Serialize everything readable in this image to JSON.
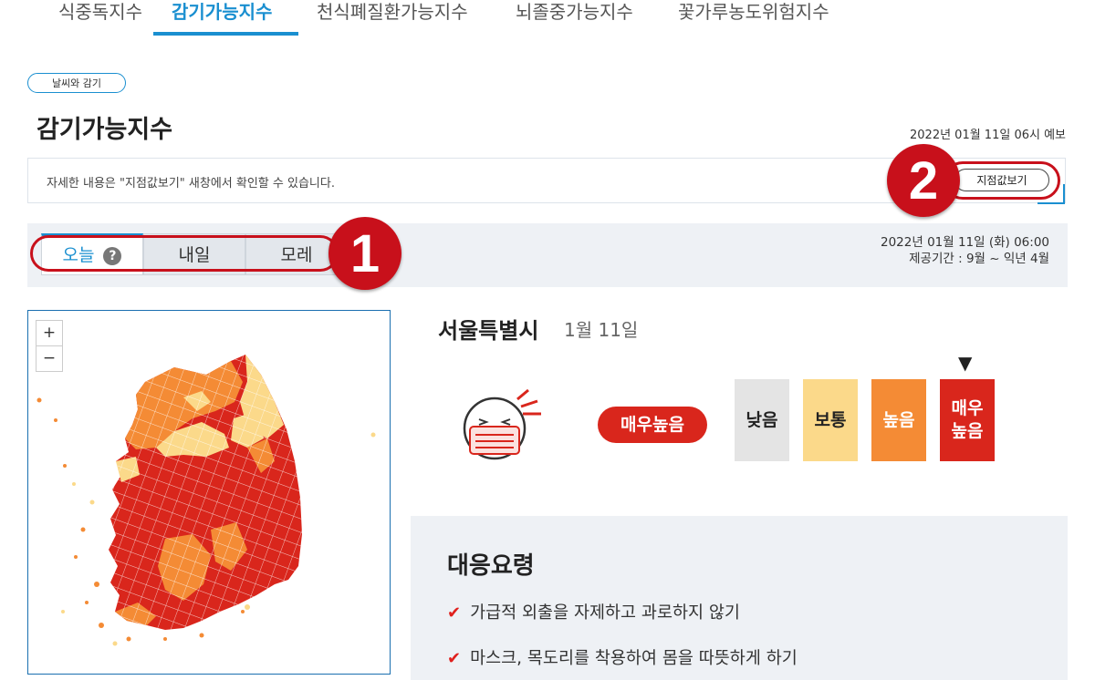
{
  "top_tabs": [
    {
      "label": "식중독지수",
      "active": false
    },
    {
      "label": "감기가능지수",
      "active": true
    },
    {
      "label": "천식폐질환가능지수",
      "active": false
    },
    {
      "label": "뇌졸중가능지수",
      "active": false
    },
    {
      "label": "꽃가루농도위험지수",
      "active": false
    }
  ],
  "breadcrumb": "날씨와 감기",
  "page_title": "감기가능지수",
  "forecast_time": "2022년 01월 11일 06시 예보",
  "notice_text": "자세한 내용은 \"지점값보기\" 새창에서 확인할 수 있습니다.",
  "station_button": "지점값보기",
  "callouts": {
    "one": "1",
    "two": "2"
  },
  "day_tabs": [
    {
      "label": "오늘",
      "active": true,
      "help": "?"
    },
    {
      "label": "내일",
      "active": false
    },
    {
      "label": "모레",
      "active": false
    }
  ],
  "date_info": {
    "date": "2022년 01월 11일 (화) 06:00",
    "period": "제공기간 : 9월 ~ 익년 4월"
  },
  "map": {
    "zoom_in": "+",
    "zoom_out": "−"
  },
  "location": {
    "city": "서울특별시",
    "date": "1월 11일"
  },
  "current_level": "매우높음",
  "scale": [
    {
      "label": "낮음",
      "color": "#e4e4e4",
      "text_color": "#222"
    },
    {
      "label": "보통",
      "color": "#fbd98a",
      "text_color": "#222"
    },
    {
      "label": "높음",
      "color": "#f48b35",
      "text_color": "#fff"
    },
    {
      "label": "매우\n높음",
      "color": "#d9261c",
      "text_color": "#fff",
      "selected": true
    }
  ],
  "scale_marker": "▼",
  "response": {
    "title": "대응요령",
    "items": [
      "가급적 외출을 자제하고 과로하지 않기",
      "마스크, 목도리를 착용하여 몸을 따뜻하게 하기"
    ]
  },
  "colors": {
    "accent": "#1a8fd0",
    "highlight": "#c8101b",
    "map_very_high": "#d9261c",
    "map_high": "#f48b35",
    "map_normal": "#fbd98a"
  }
}
